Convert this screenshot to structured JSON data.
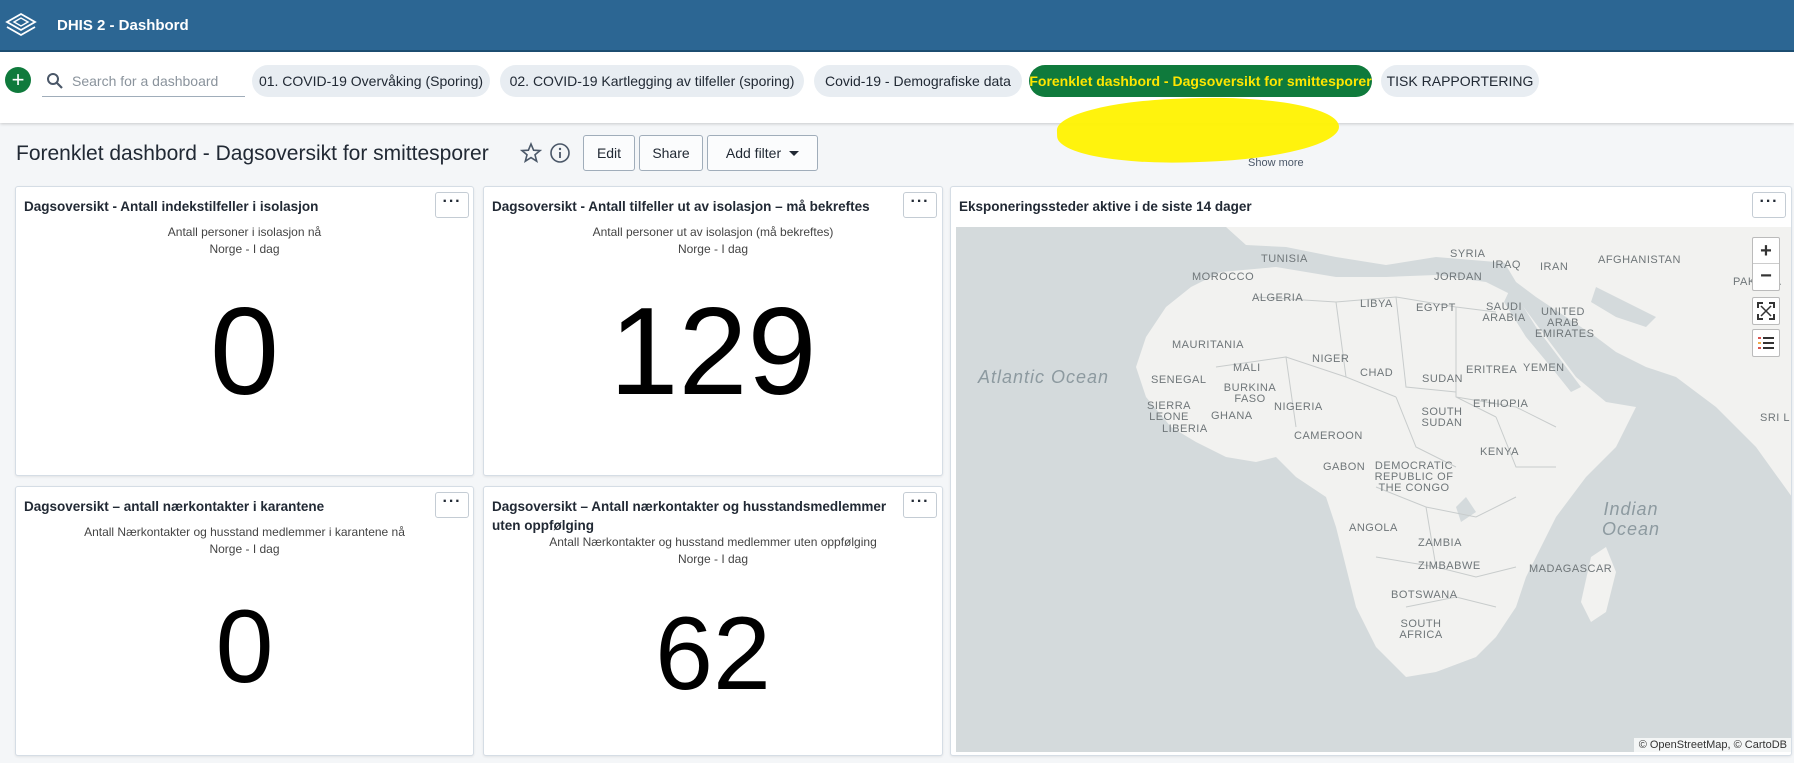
{
  "header": {
    "app_title": "DHIS 2 - Dashbord"
  },
  "dashbar": {
    "add_label": "+",
    "search_placeholder": "Search for a dashboard",
    "chips": [
      "01. COVID-19 Overvåking (Sporing)",
      "02. COVID-19 Kartlegging av tilfeller (sporing)",
      "Covid-19 - Demografiske data",
      "Forenklet dashbord - Dagsoversikt for smittesporer",
      "TISK RAPPORTERING"
    ],
    "selected_index": 3,
    "show_more": "Show more"
  },
  "title_bar": {
    "title": "Forenklet dashbord - Dagsoversikt for smittesporer",
    "edit": "Edit",
    "share": "Share",
    "add_filter": "Add filter"
  },
  "cards": [
    {
      "title": "Dagsoversikt - Antall indekstilfeller i isolasjon",
      "subtitle": "Antall personer i isolasjon nå",
      "period": "Norge - I dag",
      "value": "0"
    },
    {
      "title": "Dagsoversikt - Antall tilfeller ut av isolasjon – må bekreftes",
      "subtitle": "Antall personer ut av isolasjon (må bekreftes)",
      "period": "Norge - I dag",
      "value": "129"
    },
    {
      "title": "Dagsoversikt – antall nærkontakter i karantene",
      "subtitle": "Antall Nærkontakter og husstand medlemmer i karantene nå",
      "period": "Norge - I dag",
      "value": "0"
    },
    {
      "title": "Dagsoversikt – Antall nærkontakter og husstandsmedlemmer uten oppfølging",
      "subtitle": "Antall Nærkontakter og husstand medlemmer uten oppfølging",
      "period": "Norge - I dag",
      "value": "62"
    }
  ],
  "map_card": {
    "title": "Eksponeringssteder aktive i de siste 14 dager",
    "zoom_in": "+",
    "zoom_out": "−",
    "attribution": "© OpenStreetMap, © CartoDB",
    "oceans": [
      "Atlantic Ocean",
      "Indian Ocean"
    ],
    "labels": {
      "tunisia": "TUNISIA",
      "syria": "SYRIA",
      "iraq": "IRAQ",
      "iran": "IRAN",
      "afghanistan": "AFGHANISTAN",
      "morocco": "MOROCCO",
      "jordan": "JORDAN",
      "pakistan": "PAKISTA",
      "algeria": "ALGERIA",
      "libya": "LIBYA",
      "egypt": "EGYPT",
      "saudi_arabia": "SAUDI ARABIA",
      "uae": "UNITED ARAB EMIRATES",
      "mauritania": "MAURITANIA",
      "mali": "MALI",
      "niger": "NIGER",
      "chad": "CHAD",
      "sudan": "SUDAN",
      "eritrea": "ERITREA",
      "yemen": "YEMEN",
      "senegal": "SENEGAL",
      "burkina_faso": "BURKINA FASO",
      "sierra_leone": "SIERRA LEONE",
      "liberia": "LIBERIA",
      "ghana": "GHANA",
      "nigeria": "NIGERIA",
      "south_sudan": "SOUTH SUDAN",
      "ethiopia": "ETHIOPIA",
      "sri_lanka": "SRI L",
      "cameroon": "CAMEROON",
      "kenya": "KENYA",
      "gabon": "GABON",
      "drc": "DEMOCRATIC REPUBLIC OF THE CONGO",
      "angola": "ANGOLA",
      "zambia": "ZAMBIA",
      "zimbabwe": "ZIMBABWE",
      "madagascar": "MADAGASCAR",
      "botswana": "BOTSWANA",
      "south_africa": "SOUTH AFRICA"
    }
  }
}
